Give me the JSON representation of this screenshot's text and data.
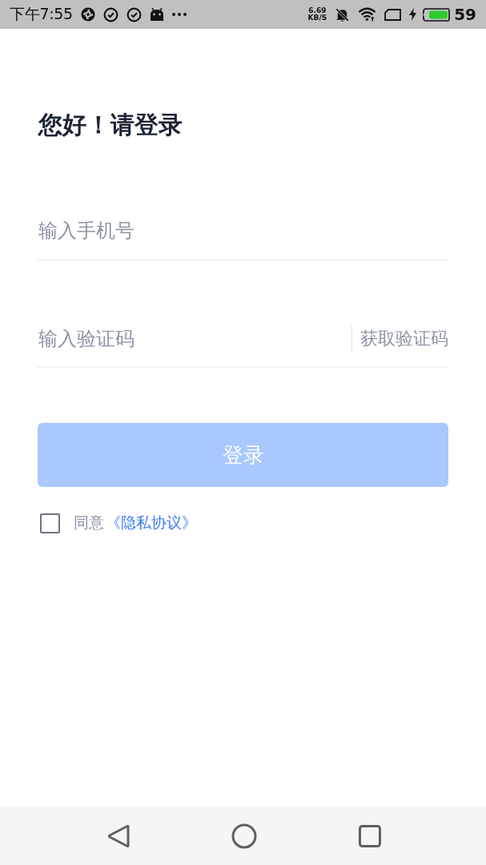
{
  "status_bar": {
    "time": "下午7:55",
    "net_speed": {
      "value": "6.69",
      "unit": "KB/S"
    },
    "battery_percent": "59"
  },
  "title": "您好！请登录",
  "phone_field": {
    "placeholder": "输入手机号"
  },
  "code_field": {
    "placeholder": "输入验证码",
    "get_code_button": "获取验证码"
  },
  "login_button": {
    "label": "登录",
    "disabled": true
  },
  "agreement": {
    "checked": false,
    "prefix": "同意",
    "link": "《隐私协议》"
  }
}
